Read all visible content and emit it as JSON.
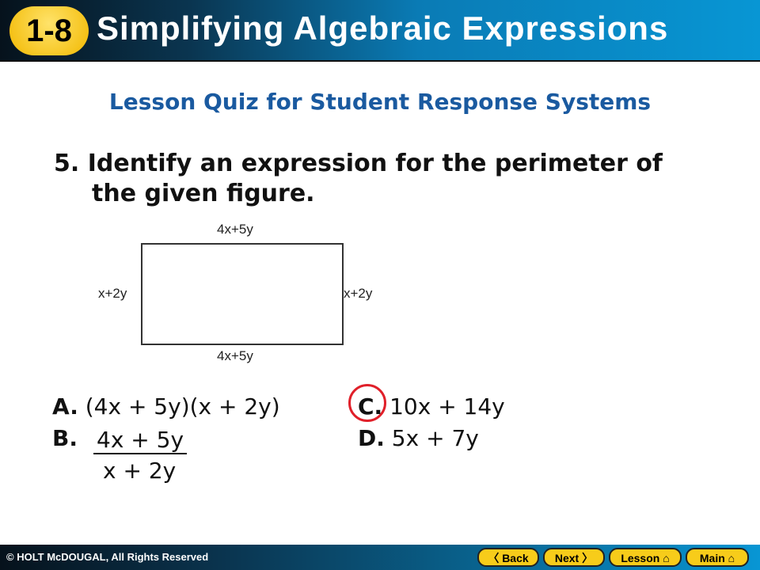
{
  "header": {
    "badge": "1-8",
    "title": "Simplifying Algebraic Expressions"
  },
  "subtitle": "Lesson Quiz for Student Response Systems",
  "question": {
    "line1": "5. Identify an expression for the perimeter of",
    "line2": "the given figure."
  },
  "figure": {
    "top": "4x+5y",
    "bottom": "4x+5y",
    "left": "x+2y",
    "right": "x+2y"
  },
  "answers": {
    "a_letter": "A.",
    "a": "(4x + 5y)(x + 2y)",
    "b_letter": "B.",
    "b_num": "4x + 5y",
    "b_den": "x + 2y",
    "c_letter": "C.",
    "c": "10x + 14y",
    "d_letter": "D.",
    "d": "5x + 7y",
    "selected": "C",
    "circle_color": "#e0202a"
  },
  "footer": {
    "copyright": "© HOLT McDOUGAL, All Rights Reserved",
    "back": "〈 Back",
    "next": "Next 〉",
    "lesson": "Lesson ⌂",
    "main": "Main ⌂"
  }
}
